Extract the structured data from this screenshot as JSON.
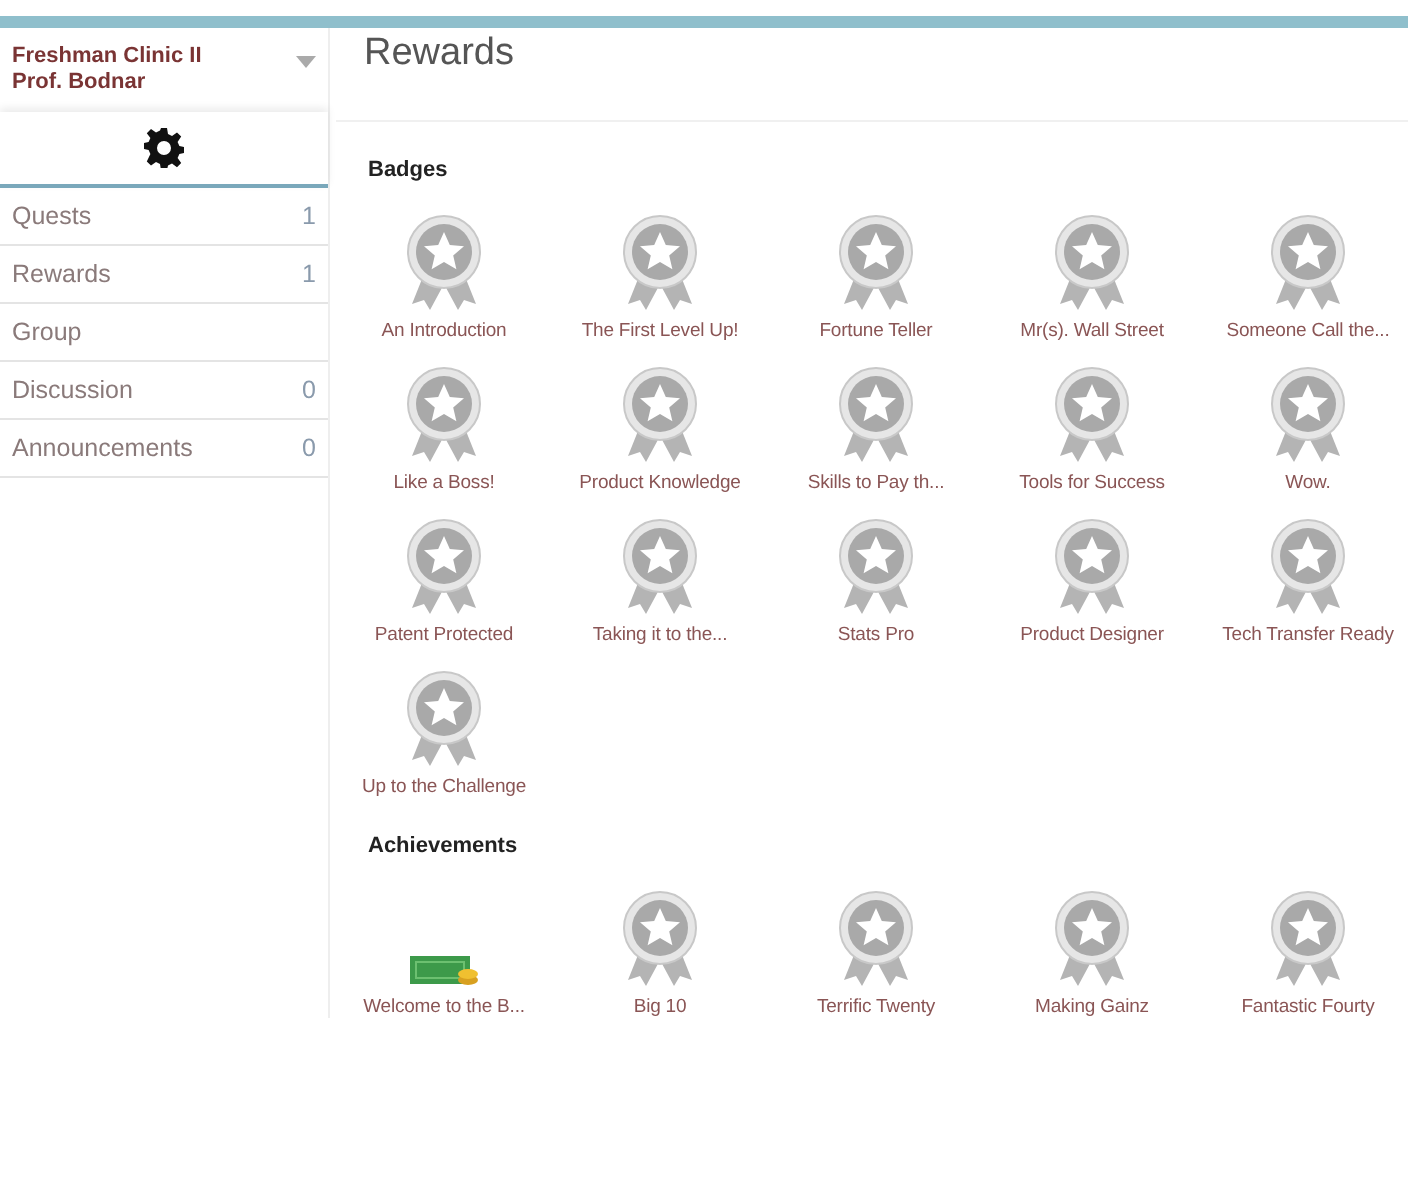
{
  "sidebar": {
    "course": "Freshman Clinic II",
    "instructor": "Prof. Bodnar",
    "items": [
      {
        "label": "Quests",
        "count": "1"
      },
      {
        "label": "Rewards",
        "count": "1"
      },
      {
        "label": "Group"
      },
      {
        "label": "Discussion",
        "count": "0"
      },
      {
        "label": "Announcements",
        "count": "0"
      }
    ]
  },
  "page_title": "Rewards",
  "sections": [
    {
      "title": "Badges",
      "items": [
        {
          "kind": "medal",
          "label": "An Introduction"
        },
        {
          "kind": "medal",
          "label": "The First Level Up!"
        },
        {
          "kind": "medal",
          "label": "Fortune Teller"
        },
        {
          "kind": "medal",
          "label": "Mr(s). Wall Street"
        },
        {
          "kind": "medal",
          "label": "Someone Call the..."
        },
        {
          "kind": "medal",
          "label": "Like a Boss!"
        },
        {
          "kind": "medal",
          "label": "Product Knowledge"
        },
        {
          "kind": "medal",
          "label": "Skills to Pay th..."
        },
        {
          "kind": "medal",
          "label": "Tools for Success"
        },
        {
          "kind": "medal",
          "label": "Wow."
        },
        {
          "kind": "medal",
          "label": "Patent Protected"
        },
        {
          "kind": "medal",
          "label": "Taking it to the..."
        },
        {
          "kind": "medal",
          "label": "Stats Pro"
        },
        {
          "kind": "medal",
          "label": "Product Designer"
        },
        {
          "kind": "medal",
          "label": "Tech Transfer Ready"
        },
        {
          "kind": "medal",
          "label": "Up to the Challenge"
        }
      ]
    },
    {
      "title": "Achievements",
      "items": [
        {
          "kind": "money",
          "label": "Welcome to the B..."
        },
        {
          "kind": "medal",
          "label": "Big 10"
        },
        {
          "kind": "medal",
          "label": "Terrific Twenty"
        },
        {
          "kind": "medal",
          "label": "Making Gainz"
        },
        {
          "kind": "medal",
          "label": "Fantastic Fourty"
        }
      ]
    }
  ]
}
